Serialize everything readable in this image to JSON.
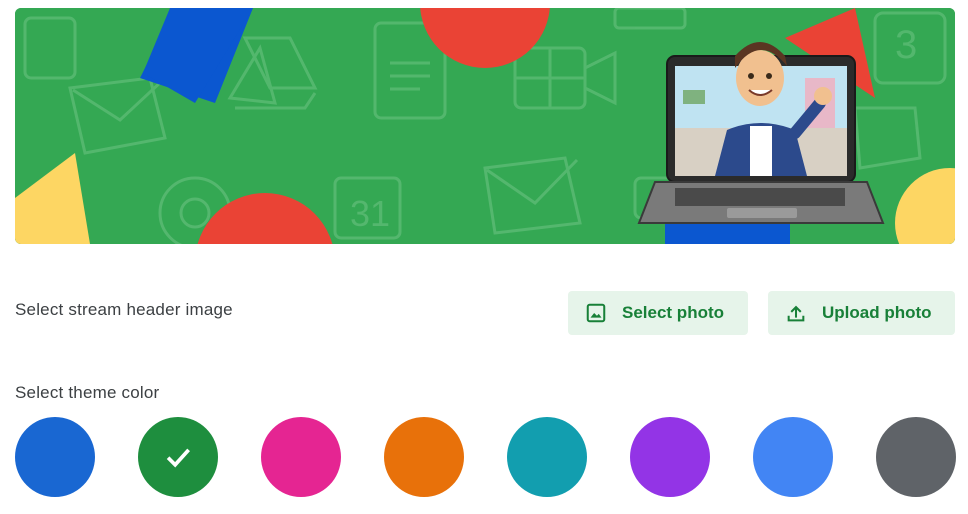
{
  "banner": {
    "illustration": "google-workspace-apps-pattern-with-bitmoji-waving-from-laptop"
  },
  "header_image": {
    "label": "Select stream header image",
    "select_photo_label": "Select photo",
    "select_photo_icon": "image-icon",
    "upload_photo_label": "Upload photo",
    "upload_photo_icon": "upload-icon"
  },
  "theme": {
    "label": "Select theme color",
    "selected_index": 1,
    "colors": [
      {
        "name": "blue",
        "hex": "#1967d2"
      },
      {
        "name": "green",
        "hex": "#1e8e3e"
      },
      {
        "name": "pink",
        "hex": "#e52592"
      },
      {
        "name": "orange",
        "hex": "#e8710a"
      },
      {
        "name": "teal",
        "hex": "#129eaf"
      },
      {
        "name": "purple",
        "hex": "#9334e6"
      },
      {
        "name": "light-blue",
        "hex": "#4285f4"
      },
      {
        "name": "grey",
        "hex": "#5f6368"
      }
    ]
  },
  "colors": {
    "banner_bg": "#34a853",
    "button_bg": "#e6f4ea",
    "button_text": "#188038",
    "label_text": "#3c4043"
  }
}
